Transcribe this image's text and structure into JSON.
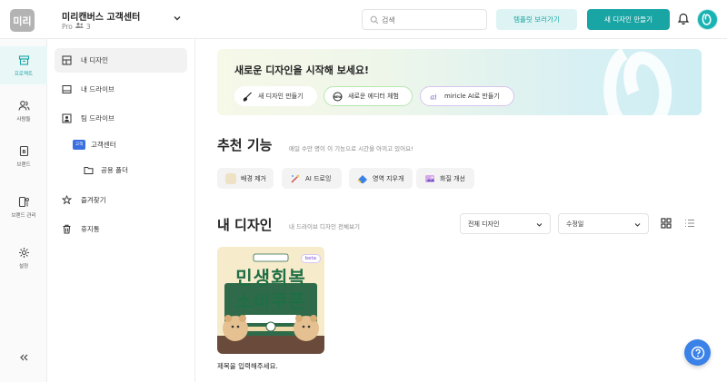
{
  "workspace": {
    "avatar_text": "미리",
    "name": "미리캔버스 고객센터",
    "plan": "Pro",
    "member_count": "3"
  },
  "header": {
    "search_placeholder": "검색",
    "template_button": "템플릿 보러가기",
    "new_design_button": "새 디자인 만들기"
  },
  "rail": {
    "items": [
      {
        "label": "프로젝트",
        "icon": "folder-icon"
      },
      {
        "label": "사람들",
        "icon": "people-icon"
      },
      {
        "label": "브랜드",
        "icon": "brand-icon"
      },
      {
        "label": "브랜드 관리",
        "icon": "brand-manage-icon"
      },
      {
        "label": "설정",
        "icon": "gear-icon"
      }
    ]
  },
  "sidenav": {
    "my_design": "내 디자인",
    "my_drive": "내 드라이브",
    "team_drive": "팀 드라이브",
    "team_badge": "고객",
    "team_name": "고객센터",
    "shared_folder": "공용 폴더",
    "favorites": "즐겨찾기",
    "trash": "휴지통"
  },
  "banner": {
    "title": "새로운 디자인을 시작해 보세요!",
    "new_design": "새 디자인 만들기",
    "new_editor": "새로운 에디터 체험",
    "ai_make": "miricle AI로 만들기"
  },
  "recommend": {
    "title": "추천 기능",
    "subtitle": "매일 수만 명이 이 기능으로 시간을 아끼고 있어요!",
    "chips": [
      "배경 제거",
      "AI 드로잉",
      "영역 지우개",
      "화질 개선"
    ]
  },
  "my_designs": {
    "title": "내 디자인",
    "subtitle": "내 드라이브 디자인 전체보기",
    "filter": "전체 디자인",
    "sort": "수정일",
    "card": {
      "badge": "beta",
      "line1": "민생회복",
      "line2": "소비쿠폰",
      "title": "제목을 입력해주세요."
    }
  },
  "colors": {
    "accent": "#1aa5a5",
    "accent_light": "#def4f4",
    "help": "#3a82e8"
  }
}
